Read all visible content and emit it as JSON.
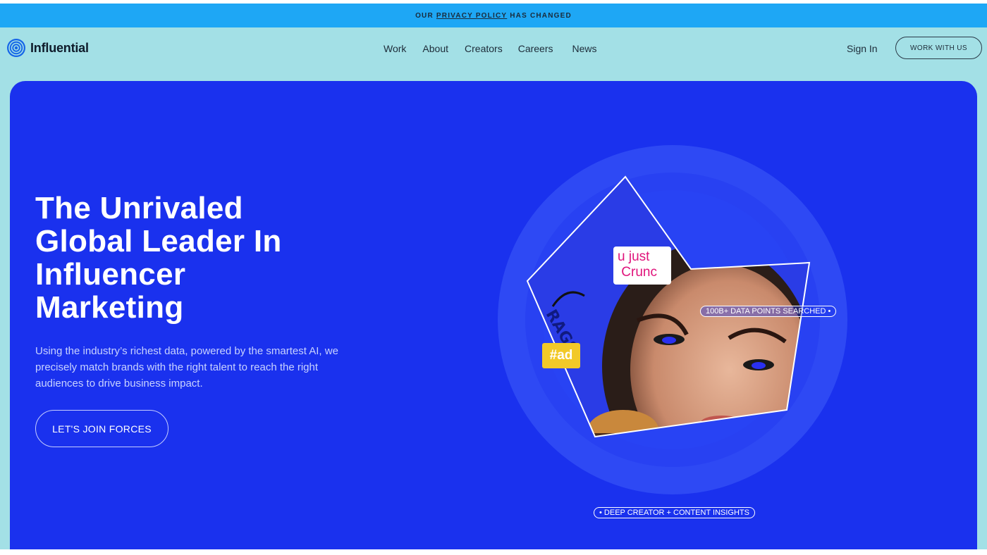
{
  "announcement": {
    "prefix": "OUR",
    "link": "PRIVACY POLICY",
    "suffix": "HAS CHANGED"
  },
  "brand": {
    "name": "Influential"
  },
  "nav": {
    "links": [
      "Work",
      "About",
      "Creators",
      "Careers",
      "News"
    ],
    "sign_in": "Sign In",
    "cta": "WORK WITH US"
  },
  "hero": {
    "title_lines": [
      "The Unrivaled",
      "Global Leader In",
      "Influencer",
      "Marketing"
    ],
    "description": "Using the industry’s richest data, powered by the smartest AI, we precisely match brands with the right talent to reach the right audiences to drive business impact.",
    "cta": "LET'S JOIN FORCES",
    "visual": {
      "pill_top": "100B+ DATA POINTS SEARCHED •",
      "pill_bottom": "• DEEP CREATOR + CONTENT INSIGHTS",
      "ad_tag": "#ad",
      "quote_tag": "u just\n Crunc"
    }
  },
  "colors": {
    "announcement_bg": "#1ea7f5",
    "page_bg": "#a3e0e6",
    "hero_bg": "#1a31ee",
    "ad_tag": "#f2c928",
    "quote_text": "#e0127a"
  }
}
